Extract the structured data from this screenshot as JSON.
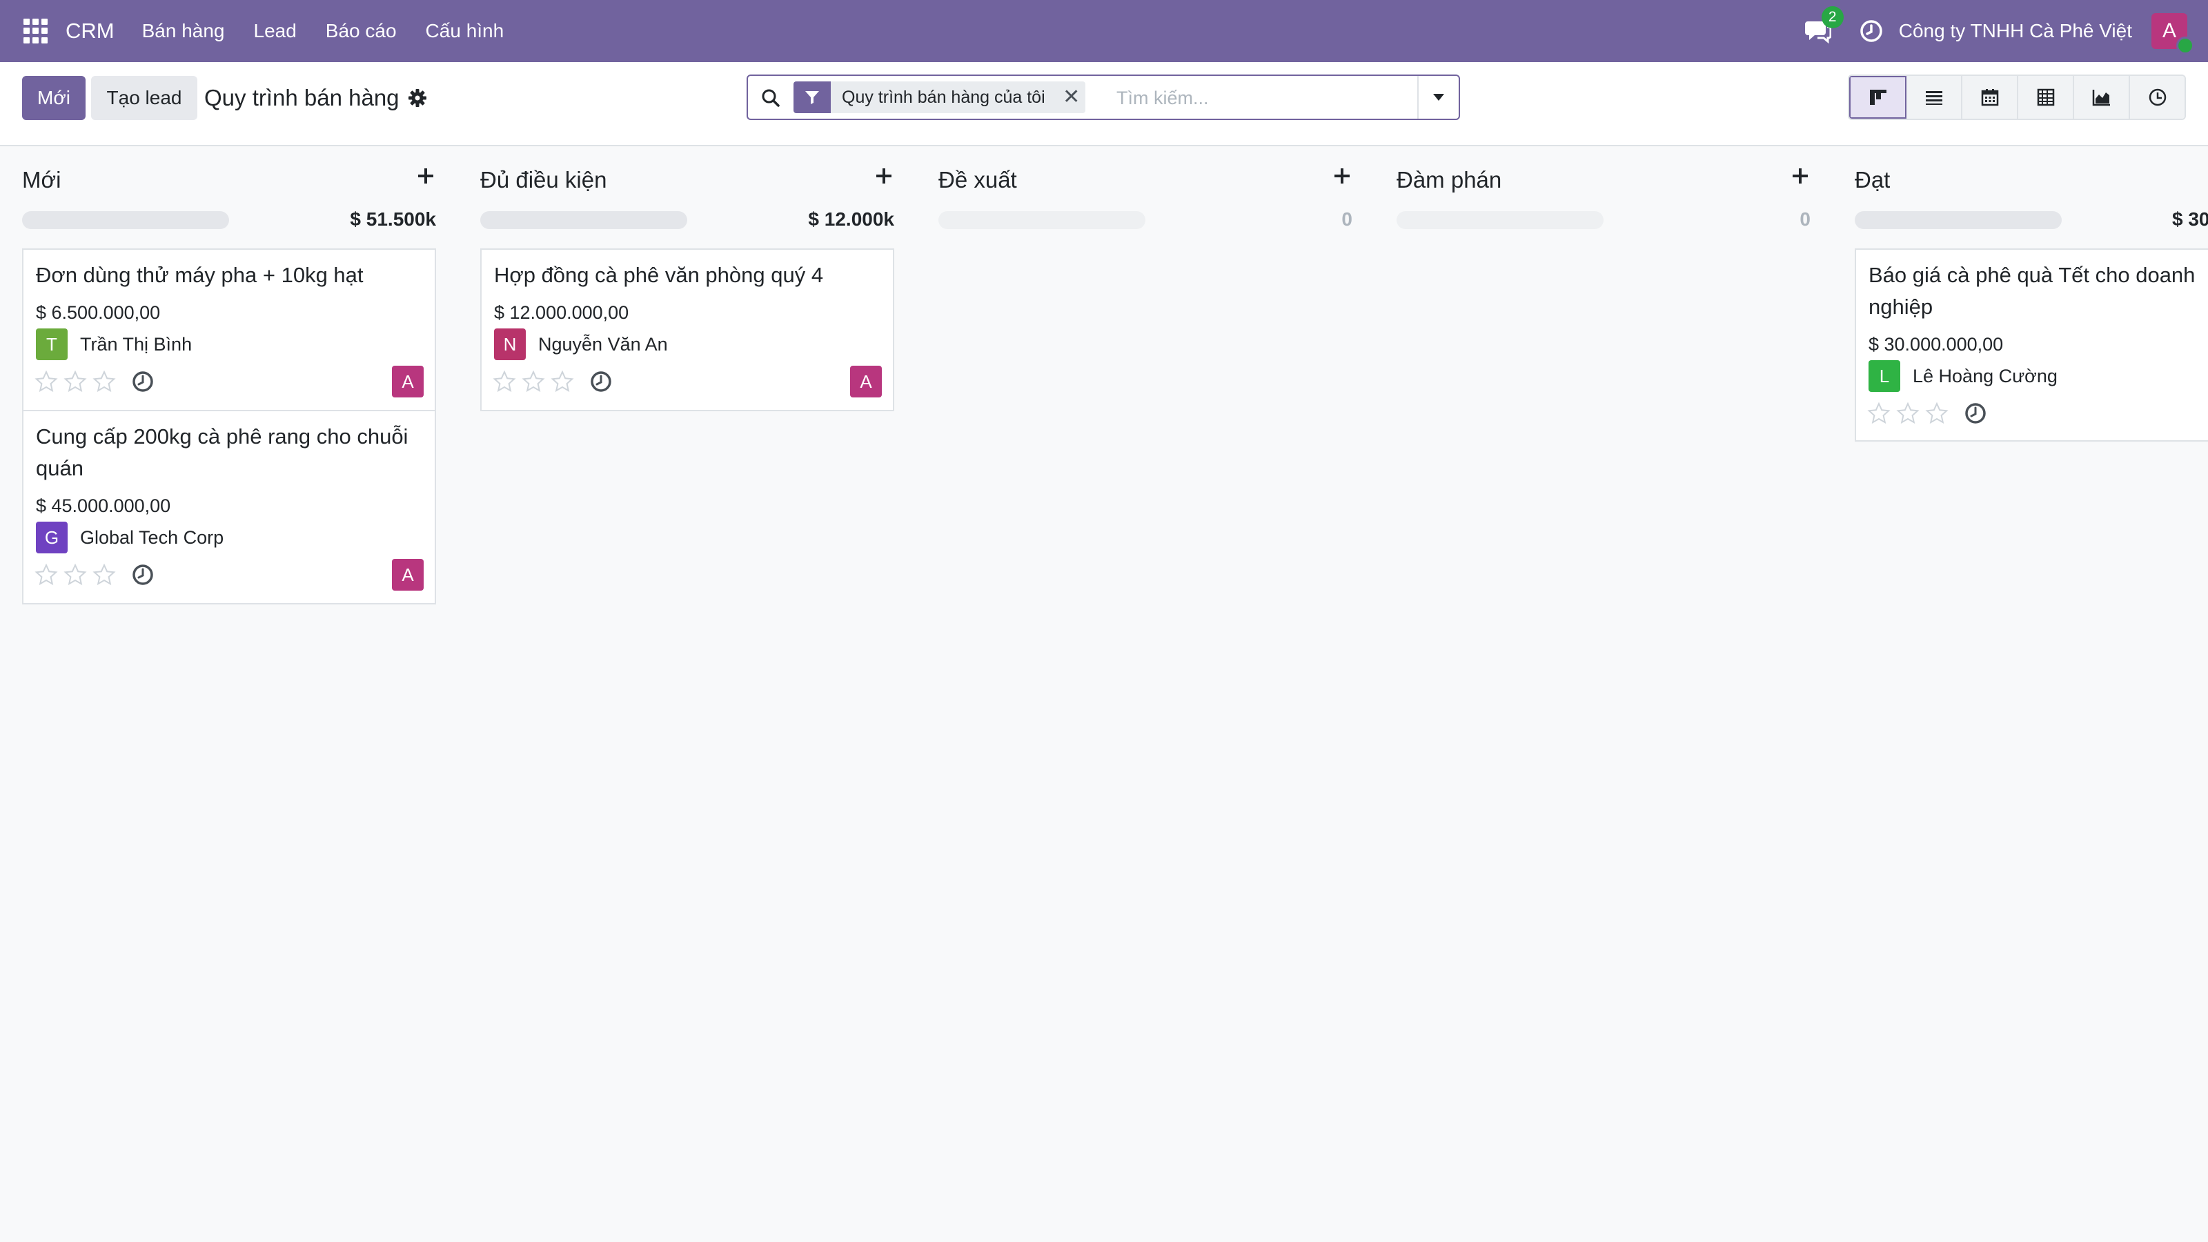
{
  "navbar": {
    "brand": "CRM",
    "menu": [
      "Bán hàng",
      "Lead",
      "Báo cáo",
      "Cấu hình"
    ],
    "messages_count": "2",
    "company": "Công ty TNHH Cà Phê Việt",
    "user_initial": "A",
    "color": "#71639e"
  },
  "control": {
    "new_label": "Mới",
    "create_lead_label": "Tạo lead",
    "breadcrumb": "Quy trình bán hàng",
    "search": {
      "facet": "Quy trình bán hàng của tôi",
      "placeholder": "Tìm kiếm..."
    },
    "views": [
      "kanban-icon",
      "list-icon",
      "calendar-icon",
      "pivot-icon",
      "graph-icon",
      "activity-icon"
    ],
    "active_view": "kanban"
  },
  "columns": [
    {
      "title": "Mới",
      "total": "$ 51.500k",
      "cards": [
        {
          "title": "Đơn dùng thử máy pha + 10kg hạt",
          "amount": "$ 6.500.000,00",
          "customer_initial": "T",
          "customer": "Trần Thị Bình",
          "customer_color": "#6bab3c",
          "stars": 0,
          "user_initial": "A"
        },
        {
          "title": "Cung cấp 200kg cà phê rang cho chuỗi quán",
          "amount": "$ 45.000.000,00",
          "customer_initial": "G",
          "customer": "Global Tech Corp",
          "customer_color": "#6f42c1",
          "stars": 0,
          "user_initial": "A"
        }
      ]
    },
    {
      "title": "Đủ điều kiện",
      "total": "$ 12.000k",
      "cards": [
        {
          "title": "Hợp đồng cà phê văn phòng quý 4",
          "amount": "$ 12.000.000,00",
          "customer_initial": "N",
          "customer": "Nguyễn Văn An",
          "customer_color": "#b8336a",
          "stars": 0,
          "user_initial": "A"
        }
      ]
    },
    {
      "title": "Đề xuất",
      "total": "0",
      "cards": []
    },
    {
      "title": "Đàm phán",
      "total": "0",
      "cards": []
    },
    {
      "title": "Đạt",
      "total": "$ 30",
      "cards": [
        {
          "title": "Báo giá cà phê quà Tết cho doanh nghiệp",
          "amount": "$ 30.000.000,00",
          "customer_initial": "L",
          "customer": "Lê Hoàng Cường",
          "customer_color": "#2fb344",
          "stars": 0
        }
      ]
    }
  ]
}
